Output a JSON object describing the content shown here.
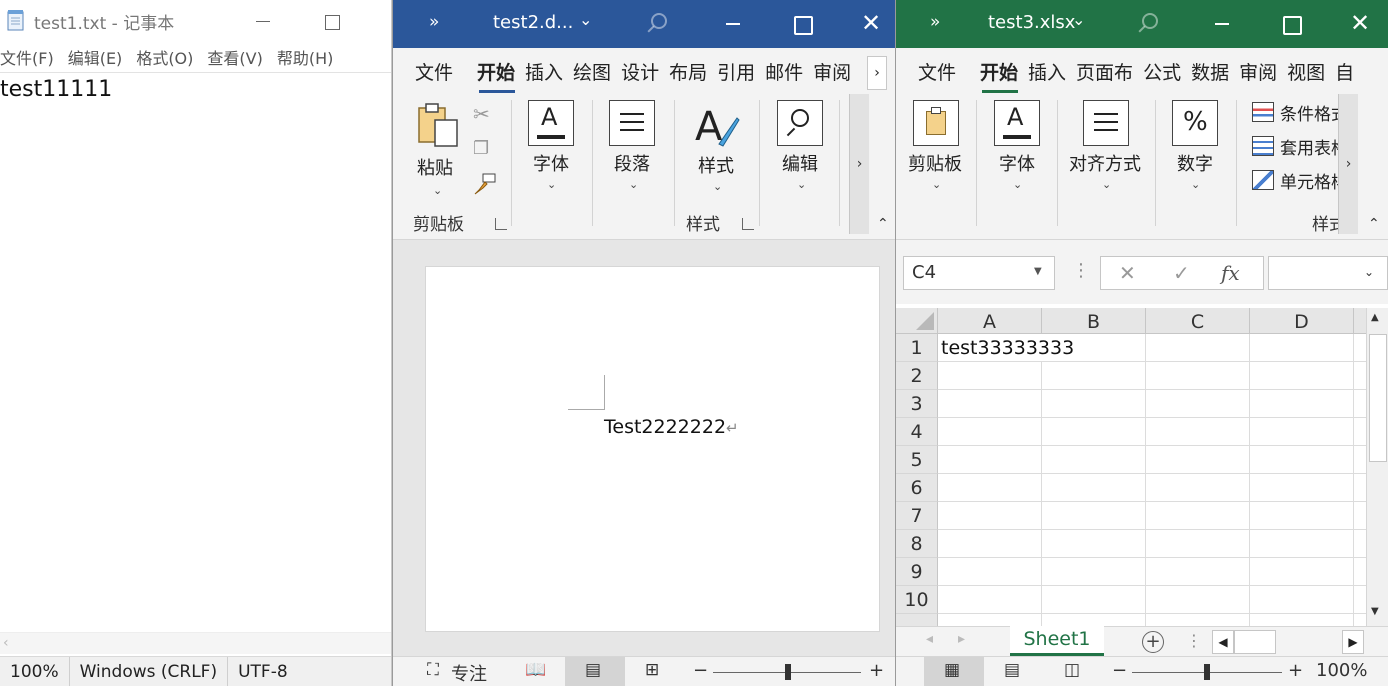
{
  "notepad": {
    "title": "test1.txt - 记事本",
    "menu": [
      "文件(F)",
      "编辑(E)",
      "格式(O)",
      "查看(V)",
      "帮助(H)"
    ],
    "content": "test11111",
    "status": {
      "zoom": "100%",
      "line_ending": "Windows (CRLF)",
      "encoding": "UTF-8"
    }
  },
  "word": {
    "title": "test2.d...",
    "tabs": [
      "文件",
      "开始",
      "插入",
      "绘图",
      "设计",
      "布局",
      "引用",
      "邮件",
      "审阅"
    ],
    "active_tab": "开始",
    "ribbon": {
      "paste": "粘贴",
      "clipboard_group": "剪贴板",
      "font": "字体",
      "paragraph": "段落",
      "styles": "样式",
      "styles_group": "样式",
      "editing": "编辑"
    },
    "document_text": "Test2222222",
    "paragraph_mark": "↵",
    "status": {
      "focus": "专注"
    },
    "accent": "#2b579a"
  },
  "excel": {
    "title": "test3.xlsx",
    "tabs": [
      "文件",
      "开始",
      "插入",
      "页面布",
      "公式",
      "数据",
      "审阅",
      "视图",
      "自"
    ],
    "active_tab": "开始",
    "ribbon": {
      "clipboard": "剪贴板",
      "font": "字体",
      "alignment": "对齐方式",
      "number": "数字",
      "conditional_format": "条件格式",
      "format_table": "套用表格",
      "cell_styles": "单元格样",
      "styles_group": "样式"
    },
    "name_box": "C4",
    "formula_fx": "fx",
    "columns": [
      "A",
      "B",
      "C",
      "D"
    ],
    "rows": [
      "1",
      "2",
      "3",
      "4",
      "5",
      "6",
      "7",
      "8",
      "9",
      "10"
    ],
    "cells": {
      "A1": "test33333333"
    },
    "sheet_tab": "Sheet1",
    "status": {
      "zoom": "100%"
    },
    "accent": "#217346"
  }
}
